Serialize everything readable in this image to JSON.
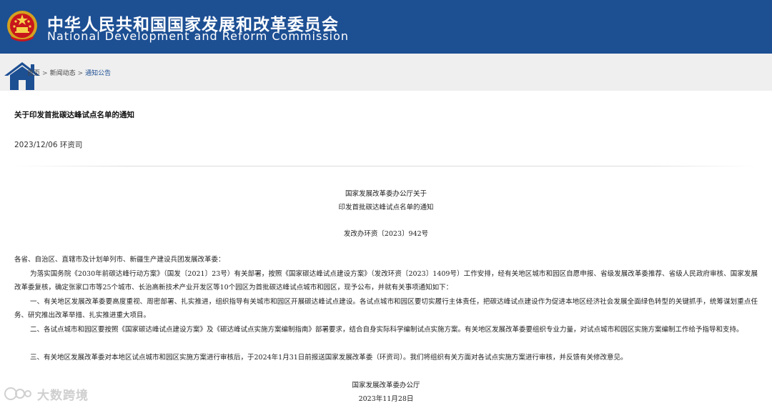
{
  "header": {
    "title_cn": "中华人民共和国国家发展和改革委员会",
    "title_en": "National Development and Reform Commission",
    "bg_color": "#1d4f93"
  },
  "breadcrumb": {
    "items": [
      "首页",
      "新闻动态",
      "通知公告"
    ],
    "separator": ">"
  },
  "article": {
    "title": "关于印发首批碳达峰试点名单的通知",
    "meta": "2023/12/06 环资司"
  },
  "document": {
    "heading_line1": "国家发展改革委办公厅关于",
    "heading_line2": "印发首批碳达峰试点名单的通知",
    "doc_number": "发改办环资〔2023〕942号",
    "salutation": "各省、自治区、直辖市及计划单列市、新疆生产建设兵团发展改革委：",
    "paragraphs": [
      "为落实国务院《2030年前碳达峰行动方案》（国发〔2021〕23号）有关部署，按照《国家碳达峰试点建设方案》（发改环资〔2023〕1409号）工作安排，经有关地区城市和园区自愿申报、省级发展改革委推荐、省级人民政府审核、国家发展改革委复核，确定张家口市等25个城市、长治高新技术产业开发区等10个园区为首批碳达峰试点城市和园区，现予公布，并就有关事项通知如下：",
      "一、有关地区发展改革委要高度重视、周密部署、扎实推进，组织指导有关城市和园区开展碳达峰试点建设。各试点城市和园区要切实履行主体责任，把碳达峰试点建设作为促进本地区经济社会发展全面绿色转型的关键抓手，统筹谋划重点任务、研究推出改革举措、扎实推进重大项目。",
      "二、各试点城市和园区要按照《国家碳达峰试点建设方案》及《碳达峰试点实施方案编制指南》部署要求，结合自身实际科学编制试点实施方案。有关地区发展改革委要组织专业力量，对试点城市和园区实施方案编制工作给予指导和支持。",
      "三、有关地区发展改革委对本地区试点城市和园区实施方案进行审核后，于2024年1月31日前报送国家发展改革委（环资司）。我们将组织有关方面对各试点实施方案进行审核，并反馈有关修改意见。"
    ],
    "signature": "国家发展改革委办公厅",
    "date": "2023年11月28日"
  },
  "watermark": {
    "text": "大数跨境"
  }
}
